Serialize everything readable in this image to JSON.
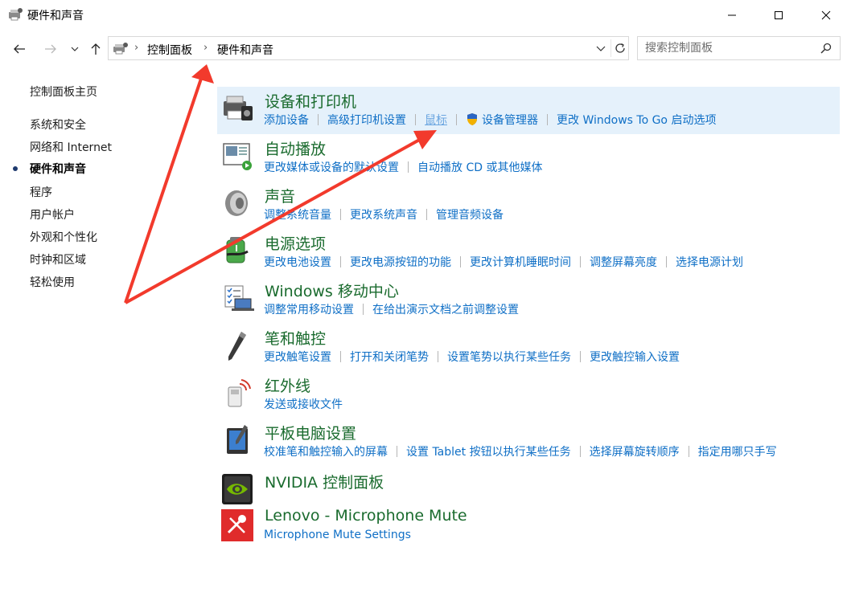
{
  "window": {
    "title": "硬件和声音",
    "icon": "control-panel-hardware-icon"
  },
  "nav": {
    "breadcrumbs": [
      "控制面板",
      "硬件和声音"
    ],
    "search_placeholder": "搜索控制面板"
  },
  "sidebar": {
    "items": [
      {
        "label": "控制面板主页"
      },
      {
        "label": "系统和安全"
      },
      {
        "label": "网络和 Internet"
      },
      {
        "label": "硬件和声音",
        "current": true
      },
      {
        "label": "程序"
      },
      {
        "label": "用户帐户"
      },
      {
        "label": "外观和个性化"
      },
      {
        "label": "时钟和区域"
      },
      {
        "label": "轻松使用"
      }
    ]
  },
  "categories": [
    {
      "title": "设备和打印机",
      "icon": "printer-icon",
      "links": [
        "添加设备",
        "高级打印机设置",
        "鼠标",
        "设备管理器",
        "更改 Windows To Go 启动选项"
      ]
    },
    {
      "title": "自动播放",
      "icon": "autoplay-icon",
      "links": [
        "更改媒体或设备的默认设置",
        "自动播放 CD 或其他媒体"
      ]
    },
    {
      "title": "声音",
      "icon": "speaker-icon",
      "links": [
        "调整系统音量",
        "更改系统声音",
        "管理音频设备"
      ]
    },
    {
      "title": "电源选项",
      "icon": "power-options-icon",
      "links": [
        "更改电池设置",
        "更改电源按钮的功能",
        "更改计算机睡眠时间",
        "调整屏幕亮度",
        "选择电源计划"
      ]
    },
    {
      "title": "Windows 移动中心",
      "icon": "mobility-center-icon",
      "links": [
        "调整常用移动设置",
        "在给出演示文档之前调整设置"
      ]
    },
    {
      "title": "笔和触控",
      "icon": "pen-icon",
      "links": [
        "更改触笔设置",
        "打开和关闭笔势",
        "设置笔势以执行某些任务",
        "更改触控输入设置"
      ]
    },
    {
      "title": "红外线",
      "icon": "infrared-icon",
      "links": [
        "发送或接收文件"
      ]
    },
    {
      "title": "平板电脑设置",
      "icon": "tablet-icon",
      "links": [
        "校准笔和触控输入的屏幕",
        "设置 Tablet 按钮以执行某些任务",
        "选择屏幕旋转顺序",
        "指定用哪只手写"
      ]
    },
    {
      "title": "NVIDIA 控制面板",
      "icon": "nvidia-icon",
      "links": []
    },
    {
      "title": "Lenovo - Microphone Mute",
      "icon": "microphone-mute-icon",
      "links": [
        "Microphone Mute Settings"
      ]
    }
  ],
  "colors": {
    "heading_green": "#1a6b2e",
    "link_blue": "#0f6fc6",
    "highlight": "#e5f1fb",
    "annotation_arrow": "#f23a2c"
  }
}
